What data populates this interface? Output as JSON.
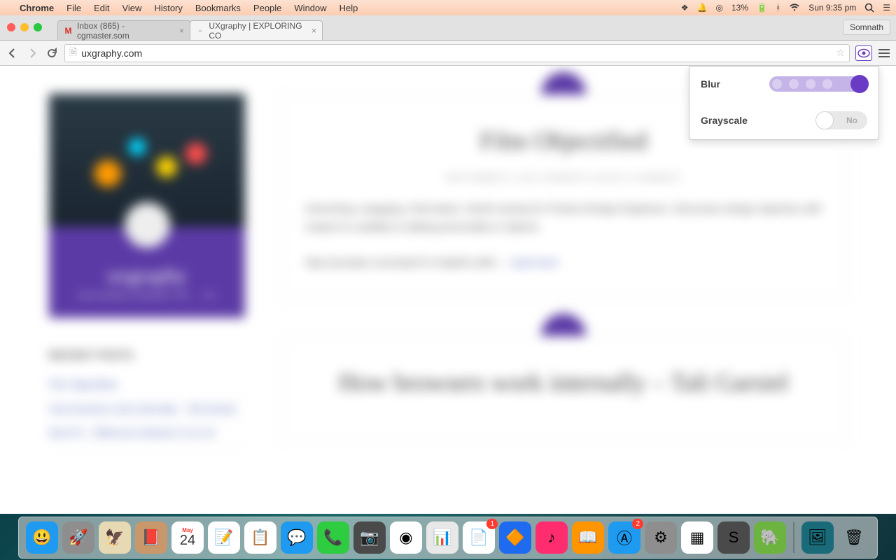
{
  "menubar": {
    "app": "Chrome",
    "items": [
      "File",
      "Edit",
      "View",
      "History",
      "Bookmarks",
      "People",
      "Window",
      "Help"
    ],
    "battery": "13%",
    "clock": "Sun 9:35 pm"
  },
  "chrome": {
    "tabs": [
      {
        "title": "Inbox (865) - cgmaster.som",
        "active": false,
        "fav": "gmail"
      },
      {
        "title": "UXgraphy | EXPLORING CO",
        "active": true,
        "fav": "page"
      }
    ],
    "profile": "Somnath",
    "url": "uxgraphy.com"
  },
  "extension": {
    "rows": [
      {
        "label": "Blur",
        "type": "slider"
      },
      {
        "label": "Grayscale",
        "type": "toggle",
        "value": "No"
      }
    ]
  },
  "page": {
    "sidebar": {
      "title": "uxgraphy",
      "subtitle": "EXPLORING CONCEPT OF ... UX",
      "recent_heading": "RECENT POSTS",
      "recent": [
        "Film Objectified",
        "How browsers work internally – Tali Garsiel",
        "Best Fit – Difference between UI & UX"
      ]
    },
    "posts": [
      {
        "title": "Film Objectified",
        "meta": "SEPTEMBER 8, 2014    SOMNATH    LEAVE A COMMENT",
        "body": "Interesting, engaging, informative. Worth seeing for Product Design Engineers. Discusses design objective with respect to usability & adding personality to objects.",
        "link": "http://youtube.com/watch?v=Nq0K0 yMN ... ",
        "read_more": "read more"
      },
      {
        "title": "How browsers work internally – Tali Garsiel",
        "meta": "",
        "body": "",
        "link": "",
        "read_more": ""
      }
    ]
  },
  "dock": {
    "icons": [
      {
        "name": "finder",
        "bg": "#1e9bf0"
      },
      {
        "name": "launchpad",
        "bg": "#8e8e8e"
      },
      {
        "name": "mail",
        "bg": "#e8d9b5"
      },
      {
        "name": "contacts",
        "bg": "#c8976a"
      },
      {
        "name": "calendar",
        "bg": "#fff",
        "text": "24",
        "sub": "May"
      },
      {
        "name": "notes",
        "bg": "#fff"
      },
      {
        "name": "reminders",
        "bg": "#fff"
      },
      {
        "name": "messages",
        "bg": "#1e9bf0"
      },
      {
        "name": "facetime",
        "bg": "#2ecc40"
      },
      {
        "name": "photobooth",
        "bg": "#4a4a4a"
      },
      {
        "name": "chrome",
        "bg": "#fff"
      },
      {
        "name": "numbers",
        "bg": "#e8e8e8"
      },
      {
        "name": "pages",
        "bg": "#fff",
        "badge": "1"
      },
      {
        "name": "keynote",
        "bg": "#1e6bf0"
      },
      {
        "name": "itunes",
        "bg": "#ff2d6f"
      },
      {
        "name": "ibooks",
        "bg": "#ff9500"
      },
      {
        "name": "appstore",
        "bg": "#1e9bf0",
        "badge": "2"
      },
      {
        "name": "settings",
        "bg": "#8e8e8e"
      },
      {
        "name": "creative",
        "bg": "#fff"
      },
      {
        "name": "sublime",
        "bg": "#4a4a4a"
      },
      {
        "name": "evernote",
        "bg": "#6db33f"
      }
    ],
    "right": [
      {
        "name": "preview",
        "bg": "#1a6b7a"
      },
      {
        "name": "trash",
        "bg": "transparent"
      }
    ]
  }
}
